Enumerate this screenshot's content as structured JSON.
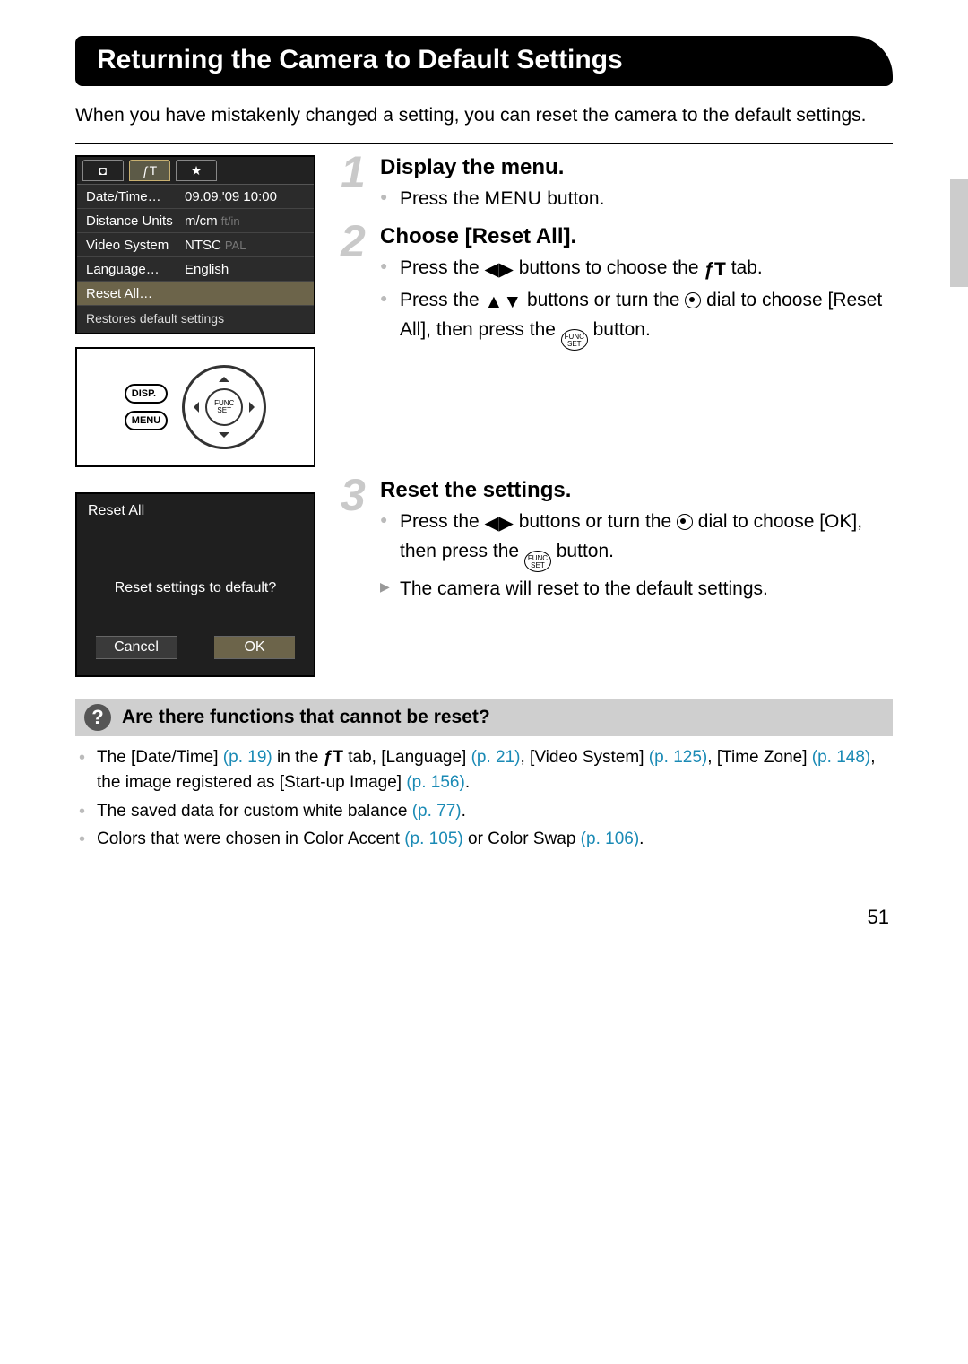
{
  "page_number": "51",
  "title": "Returning the Camera to Default Settings",
  "intro": "When you have mistakenly changed a setting, you can reset the camera to the default settings.",
  "screen1": {
    "tabs": {
      "camera": "◘",
      "tools": "ƒT",
      "star": "★"
    },
    "rows": {
      "date_time": {
        "label": "Date/Time…",
        "value": "09.09.'09 10:00"
      },
      "distance": {
        "label": "Distance Units",
        "value": "m/cm",
        "dim": "ft/in"
      },
      "video": {
        "label": "Video System",
        "value": "NTSC",
        "dim": "PAL"
      },
      "language": {
        "label": "Language…",
        "value": "English"
      },
      "reset": {
        "label": "Reset All…"
      }
    },
    "footer": "Restores default settings"
  },
  "controls": {
    "disp": "DISP.",
    "menu": "MENU",
    "func": "FUNC\nSET"
  },
  "screen2": {
    "header": "Reset All",
    "message": "Reset settings to default?",
    "cancel": "Cancel",
    "ok": "OK"
  },
  "steps": {
    "s1": {
      "num": "1",
      "title": "Display the menu.",
      "b1_a": "Press the ",
      "b1_menu": "MENU",
      "b1_b": " button."
    },
    "s2": {
      "num": "2",
      "title": "Choose [Reset All].",
      "b1_a": "Press the ",
      "b1_lr": "◀▶",
      "b1_b": " buttons to choose the ",
      "b1_tools": "ƒT",
      "b1_c": " tab.",
      "b2_a": "Press the ",
      "b2_ud": "▲▼",
      "b2_b": " buttons or turn the ",
      "b2_dial": "dial",
      "b2_c": " to choose [Reset All], then press the ",
      "b2_func_top": "FUNC",
      "b2_func_bot": "SET",
      "b2_d": " button."
    },
    "s3": {
      "num": "3",
      "title": "Reset the settings.",
      "b1_a": "Press the ",
      "b1_lr": "◀▶",
      "b1_b": " buttons or turn the ",
      "b1_c": " dial to choose [OK], then press the ",
      "b1_func_top": "FUNC",
      "b1_func_bot": "SET",
      "b1_d": " button.",
      "b2": "The camera will reset to the default settings."
    }
  },
  "qbox": {
    "title": "Are there functions that cannot be reset?",
    "i1": {
      "a": "The [Date/Time] ",
      "p1": "(p. 19)",
      "b": " in the ",
      "tools": "ƒT",
      "c": " tab, [Language] ",
      "p2": "(p. 21)",
      "d": ", [Video System] ",
      "p3": "(p. 125)",
      "e": ", [Time Zone] ",
      "p4": "(p. 148)",
      "f": ", the image registered as [Start-up Image] ",
      "p5": "(p. 156)",
      "g": "."
    },
    "i2": {
      "a": "The saved data for custom white balance ",
      "p1": "(p. 77)",
      "b": "."
    },
    "i3": {
      "a": "Colors that were chosen in Color Accent ",
      "p1": "(p. 105)",
      "b": " or Color Swap ",
      "p2": "(p. 106)",
      "c": "."
    }
  }
}
